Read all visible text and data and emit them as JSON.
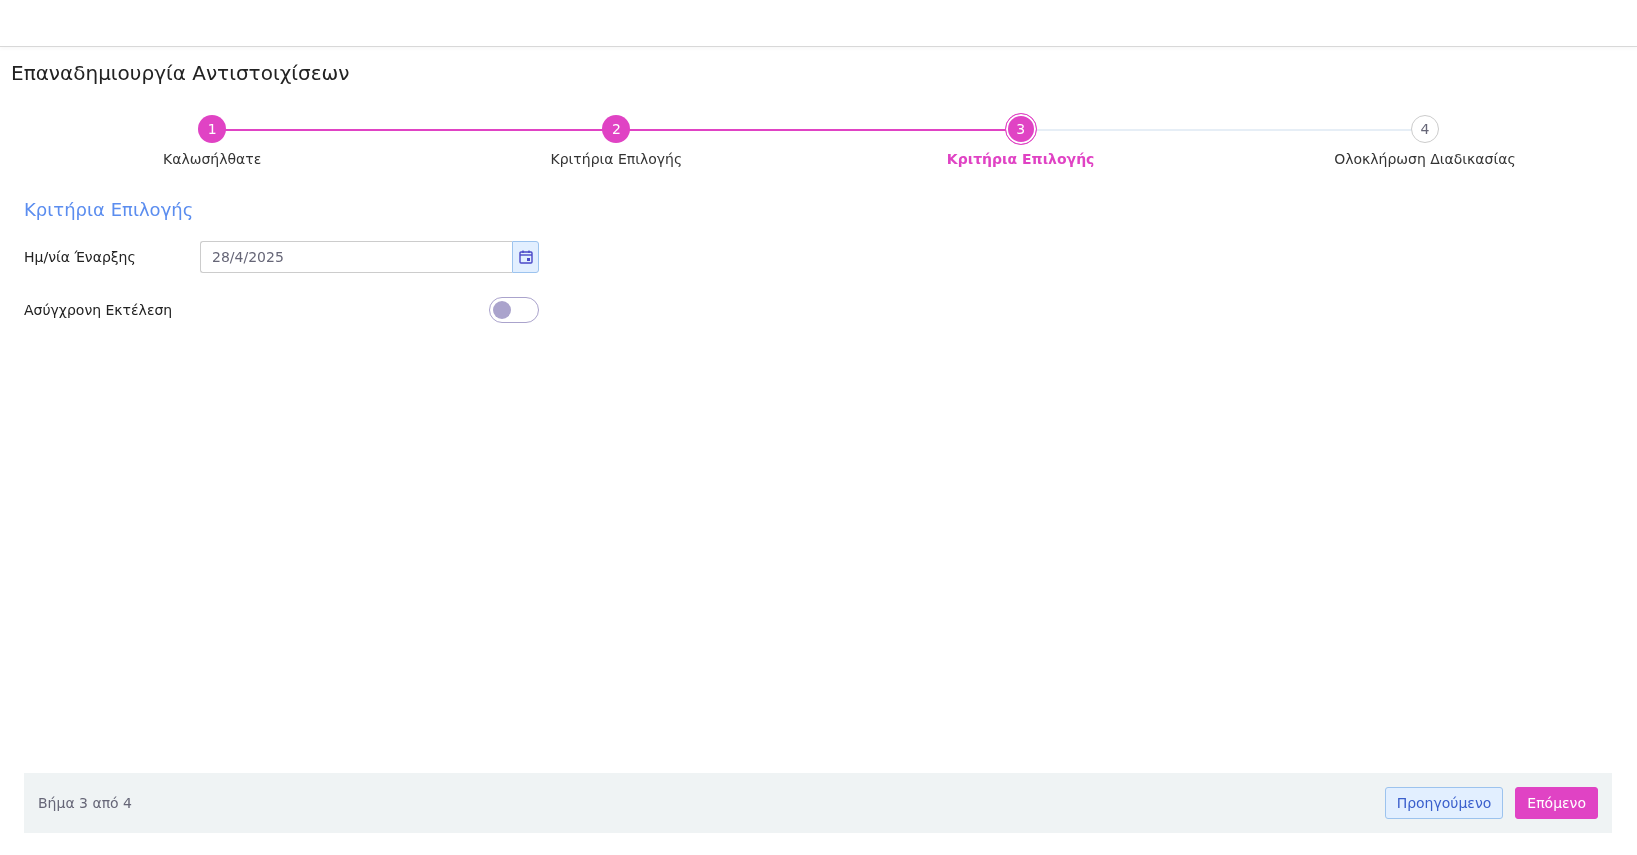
{
  "page": {
    "title": "Επαναδημιουργία Αντιστοιχίσεων"
  },
  "steps": [
    {
      "number": "1",
      "label": "Καλωσήλθατε",
      "completed": true,
      "selected": false
    },
    {
      "number": "2",
      "label": "Κριτήρια Επιλογής",
      "completed": true,
      "selected": false
    },
    {
      "number": "3",
      "label": "Κριτήρια Επιλογής",
      "completed": false,
      "selected": true
    },
    {
      "number": "4",
      "label": "Ολοκλήρωση Διαδικασίας",
      "completed": false,
      "selected": false
    }
  ],
  "section": {
    "heading": "Κριτήρια Επιλογής",
    "fields": [
      {
        "kind": "date",
        "label": "Ημ/νία Έναρξης",
        "value": "28/4/2025"
      },
      {
        "kind": "toggle",
        "label": "Ασύγχρονη Εκτέλεση",
        "on": false
      }
    ]
  },
  "footer": {
    "step_text": "Βήμα 3 από 4",
    "buttons": [
      {
        "kind": "secondary",
        "label": "Προηγούμενο"
      },
      {
        "kind": "primary",
        "label": "Επόμενο"
      }
    ]
  }
}
